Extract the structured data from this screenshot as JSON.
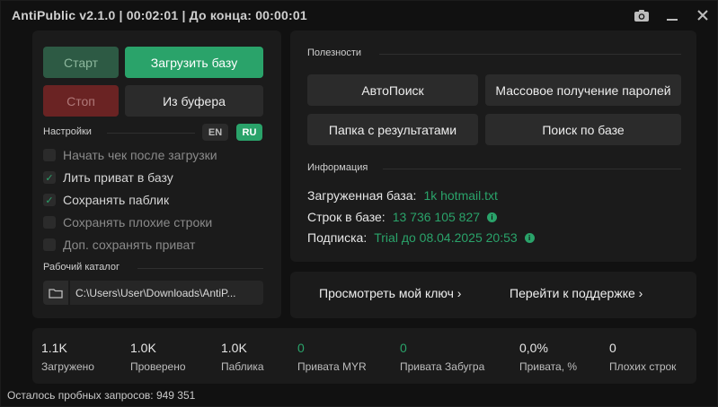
{
  "window": {
    "title": "AntiPublic v2.1.0 | 00:02:01 | До конца: 00:00:01",
    "icons": [
      "camera-icon",
      "minimize-icon",
      "close-icon"
    ]
  },
  "controls": {
    "start_label": "Старт",
    "load_label": "Загрузить базу",
    "stop_label": "Стоп",
    "clipboard_label": "Из буфера"
  },
  "settings": {
    "title": "Настройки",
    "lang_en": "EN",
    "lang_ru": "RU",
    "selected_lang": "RU",
    "options": [
      {
        "label": "Начать чек после загрузки",
        "checked": false
      },
      {
        "label": "Лить приват в базу",
        "checked": true
      },
      {
        "label": "Сохранять паблик",
        "checked": true
      },
      {
        "label": "Сохранять плохие строки",
        "checked": false
      },
      {
        "label": "Доп. сохранять приват",
        "checked": false
      }
    ]
  },
  "workdir": {
    "title": "Рабочий каталог",
    "path": "C:\\Users\\User\\Downloads\\AntiP..."
  },
  "utilities": {
    "title": "Полезности",
    "autosearch": "АвтоПоиск",
    "mass_passwords": "Массовое получение паролей",
    "results_folder": "Папка с результатами",
    "db_search": "Поиск по базе"
  },
  "info": {
    "title": "Информация",
    "loaded_label": "Загруженная база:",
    "loaded_value": "1k hotmail.txt",
    "lines_label": "Строк в базе:",
    "lines_value": "13 736 105 827",
    "sub_label": "Подписка:",
    "sub_value": "Trial до 08.04.2025 20:53"
  },
  "actions": {
    "view_key": "Просмотреть мой ключ ›",
    "support": "Перейти к поддержке ›"
  },
  "stats": [
    {
      "value": "1.1K",
      "label": "Загружено",
      "green": false
    },
    {
      "value": "1.0K",
      "label": "Проверено",
      "green": false
    },
    {
      "value": "1.0K",
      "label": "Паблика",
      "green": false
    },
    {
      "value": "0",
      "label": "Привата MYR",
      "green": true
    },
    {
      "value": "0",
      "label": "Привата Забугра",
      "green": true
    },
    {
      "value": "0,0%",
      "label": "Привата, %",
      "green": false
    },
    {
      "value": "0",
      "label": "Плохих строк",
      "green": false
    }
  ],
  "footer": {
    "trial_requests": "Осталось пробных запросов: 949 351"
  },
  "colors": {
    "accent": "#2aa36a",
    "stop": "#6a2323",
    "background": "#111111",
    "panel": "#1b1b1b"
  }
}
